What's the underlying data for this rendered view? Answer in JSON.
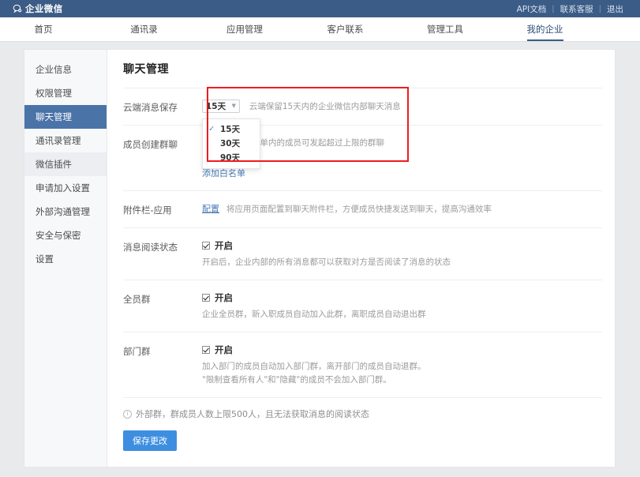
{
  "topbar": {
    "brand": "企业微信",
    "brand_icon": "speech-bubble-icon",
    "links": [
      {
        "label": "API文档"
      },
      {
        "label": "联系客服"
      },
      {
        "label": "退出"
      }
    ],
    "separator": "|"
  },
  "nav": {
    "items": [
      {
        "label": "首页",
        "active": false
      },
      {
        "label": "通讯录",
        "active": false
      },
      {
        "label": "应用管理",
        "active": false
      },
      {
        "label": "客户联系",
        "active": false
      },
      {
        "label": "管理工具",
        "active": false
      },
      {
        "label": "我的企业",
        "active": true
      }
    ]
  },
  "sidebar": {
    "items": [
      {
        "label": "企业信息",
        "state": "normal"
      },
      {
        "label": "权限管理",
        "state": "normal"
      },
      {
        "label": "聊天管理",
        "state": "active"
      },
      {
        "label": "通讯录管理",
        "state": "normal"
      },
      {
        "label": "微信插件",
        "state": "hover"
      },
      {
        "label": "申请加入设置",
        "state": "normal"
      },
      {
        "label": "外部沟通管理",
        "state": "normal"
      },
      {
        "label": "安全与保密",
        "state": "normal"
      },
      {
        "label": "设置",
        "state": "normal"
      }
    ]
  },
  "content": {
    "title": "聊天管理",
    "cloud_storage": {
      "label": "云端消息保存",
      "selected": "15天",
      "caret_icon": "chevron-down-icon",
      "description": "云端保留15天内的企业微信内部聊天消息",
      "options": [
        {
          "label": "15天",
          "checked": true
        },
        {
          "label": "30天",
          "checked": false
        },
        {
          "label": "90天",
          "checked": false
        }
      ],
      "check_icon": "check-icon"
    },
    "group_create": {
      "label": "成员创建群聊",
      "description": "设置后，仅白名单内的成员可发起超过上限的群聊",
      "whitelist_link": "添加白名单"
    },
    "attachment_app": {
      "label": "附件栏-应用",
      "config_link": "配置",
      "description": "将应用页面配置到聊天附件栏，方便成员快捷发送到聊天，提高沟通效率"
    },
    "read_status": {
      "label": "消息阅读状态",
      "toggle_label": "开启",
      "checked": true,
      "description": "开启后，企业内部的所有消息都可以获取对方是否阅读了消息的状态"
    },
    "all_staff_group": {
      "label": "全员群",
      "toggle_label": "开启",
      "checked": true,
      "description": "企业全员群，新入职成员自动加入此群，离职成员自动退出群"
    },
    "department_group": {
      "label": "部门群",
      "toggle_label": "开启",
      "checked": true,
      "description_line1": "加入部门的成员自动加入部门群，离开部门的成员自动退群。",
      "description_line2": "\"限制查看所有人\"和\"隐藏\"的成员不会加入部门群。"
    },
    "footer_note": {
      "icon": "info-circle-icon",
      "text": "外部群，群成员人数上限500人，且无法获取消息的阅读状态"
    },
    "save_button": "保存更改"
  },
  "annotation": {
    "highlight_box_color": "#ef1c1c"
  }
}
